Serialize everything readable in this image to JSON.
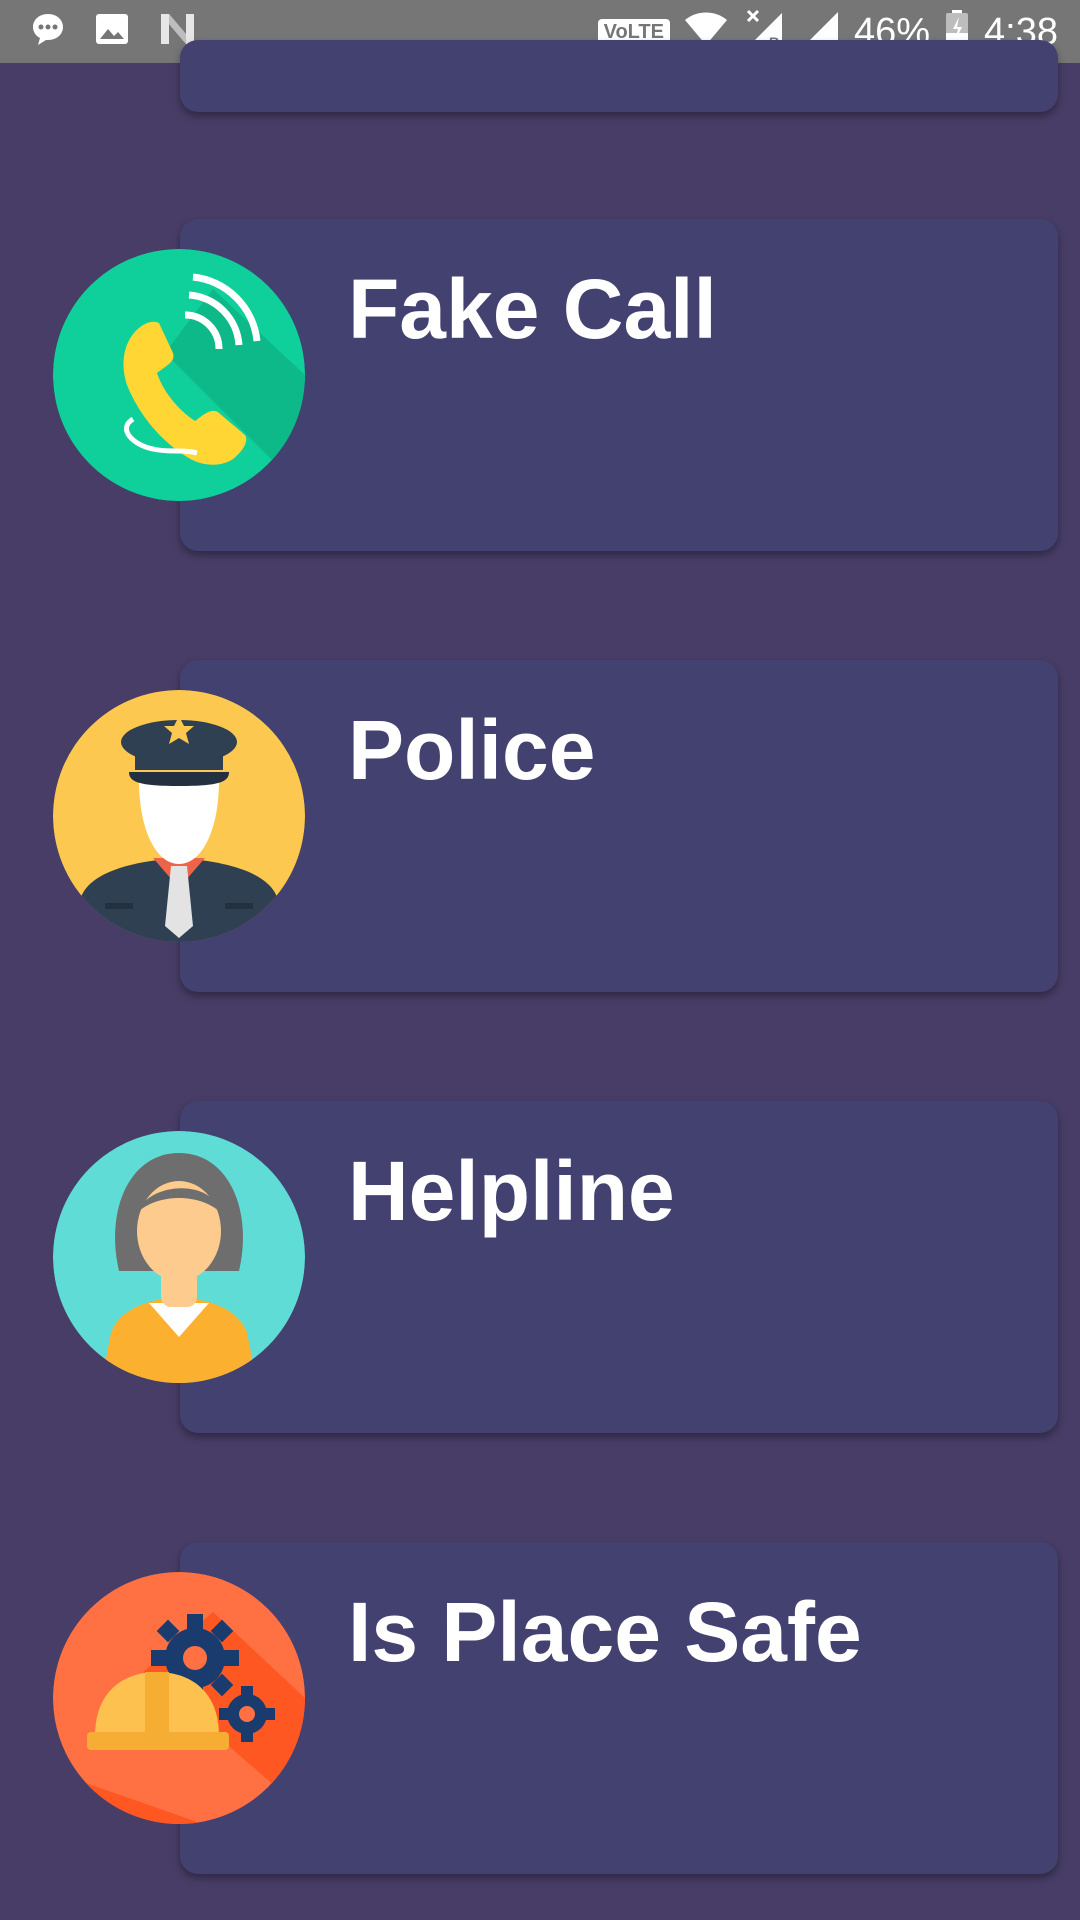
{
  "status_bar": {
    "volte_label": "VoLTE",
    "battery_percent": "46%",
    "time": "4:38",
    "icons": [
      "message-icon",
      "image-icon",
      "n-app-icon",
      "wifi-icon",
      "no-signal-roaming-icon",
      "signal-icon",
      "battery-charging-icon"
    ]
  },
  "menu": {
    "items": [
      {
        "label": "Fake Call",
        "icon": "phone-call-icon",
        "icon_bg": "#0fcf9b"
      },
      {
        "label": "Police",
        "icon": "police-officer-icon",
        "icon_bg": "#fcc84f"
      },
      {
        "label": "Helpline",
        "icon": "woman-helpline-icon",
        "icon_bg": "#5fdcd6"
      },
      {
        "label": "Is Place Safe",
        "icon": "hard-hat-gears-icon",
        "icon_bg": "#ff7043"
      }
    ]
  },
  "colors": {
    "background": "#473d66",
    "card": "#434170",
    "status_bar": "#767676",
    "text": "#ffffff"
  }
}
